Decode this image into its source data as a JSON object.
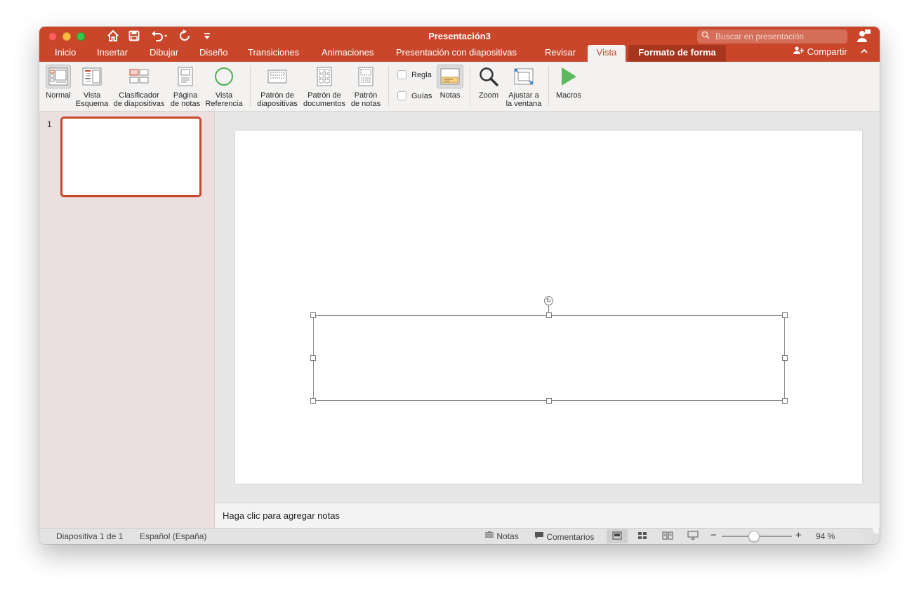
{
  "window": {
    "title": "Presentación3"
  },
  "search": {
    "placeholder": "Buscar en presentación"
  },
  "tabs": [
    "Inicio",
    "Insertar",
    "Dibujar",
    "Diseño",
    "Transiciones",
    "Animaciones",
    "Presentación con diapositivas",
    "Revisar",
    "Vista",
    "Formato de forma"
  ],
  "share_label": "Compartir",
  "ribbon": {
    "views": {
      "normal": "Normal",
      "outline": [
        "Vista",
        "Esquema"
      ],
      "sorter": [
        "Clasificador",
        "de diapositivas"
      ],
      "notes_page": [
        "Página",
        "de notas"
      ],
      "reading": [
        "Vista",
        "Referencia"
      ]
    },
    "masters": {
      "slide_master": [
        "Patrón de",
        "diapositivas"
      ],
      "handout_master": [
        "Patrón de",
        "documentos"
      ],
      "notes_master": [
        "Patrón",
        "de notas"
      ]
    },
    "show": {
      "ruler": "Regla",
      "guides": "Guías",
      "notes": "Notas"
    },
    "zoom": "Zoom",
    "fit": [
      "Ajustar a",
      "la ventana"
    ],
    "macros": "Macros"
  },
  "thumbnails": {
    "slide_number": "1"
  },
  "notes_placeholder": "Haga clic para agregar notas",
  "status": {
    "slide_info": "Diapositiva 1 de 1",
    "language": "Español (España)",
    "notes": "Notas",
    "comments": "Comentarios",
    "zoom_level": "94 %",
    "zoom_fraction": 0.46
  },
  "colors": {
    "accent": "#c9462b",
    "contextual_tab": "#a8361f",
    "macro_play": "#5cb85c",
    "reading_circle": "#4caf50"
  }
}
